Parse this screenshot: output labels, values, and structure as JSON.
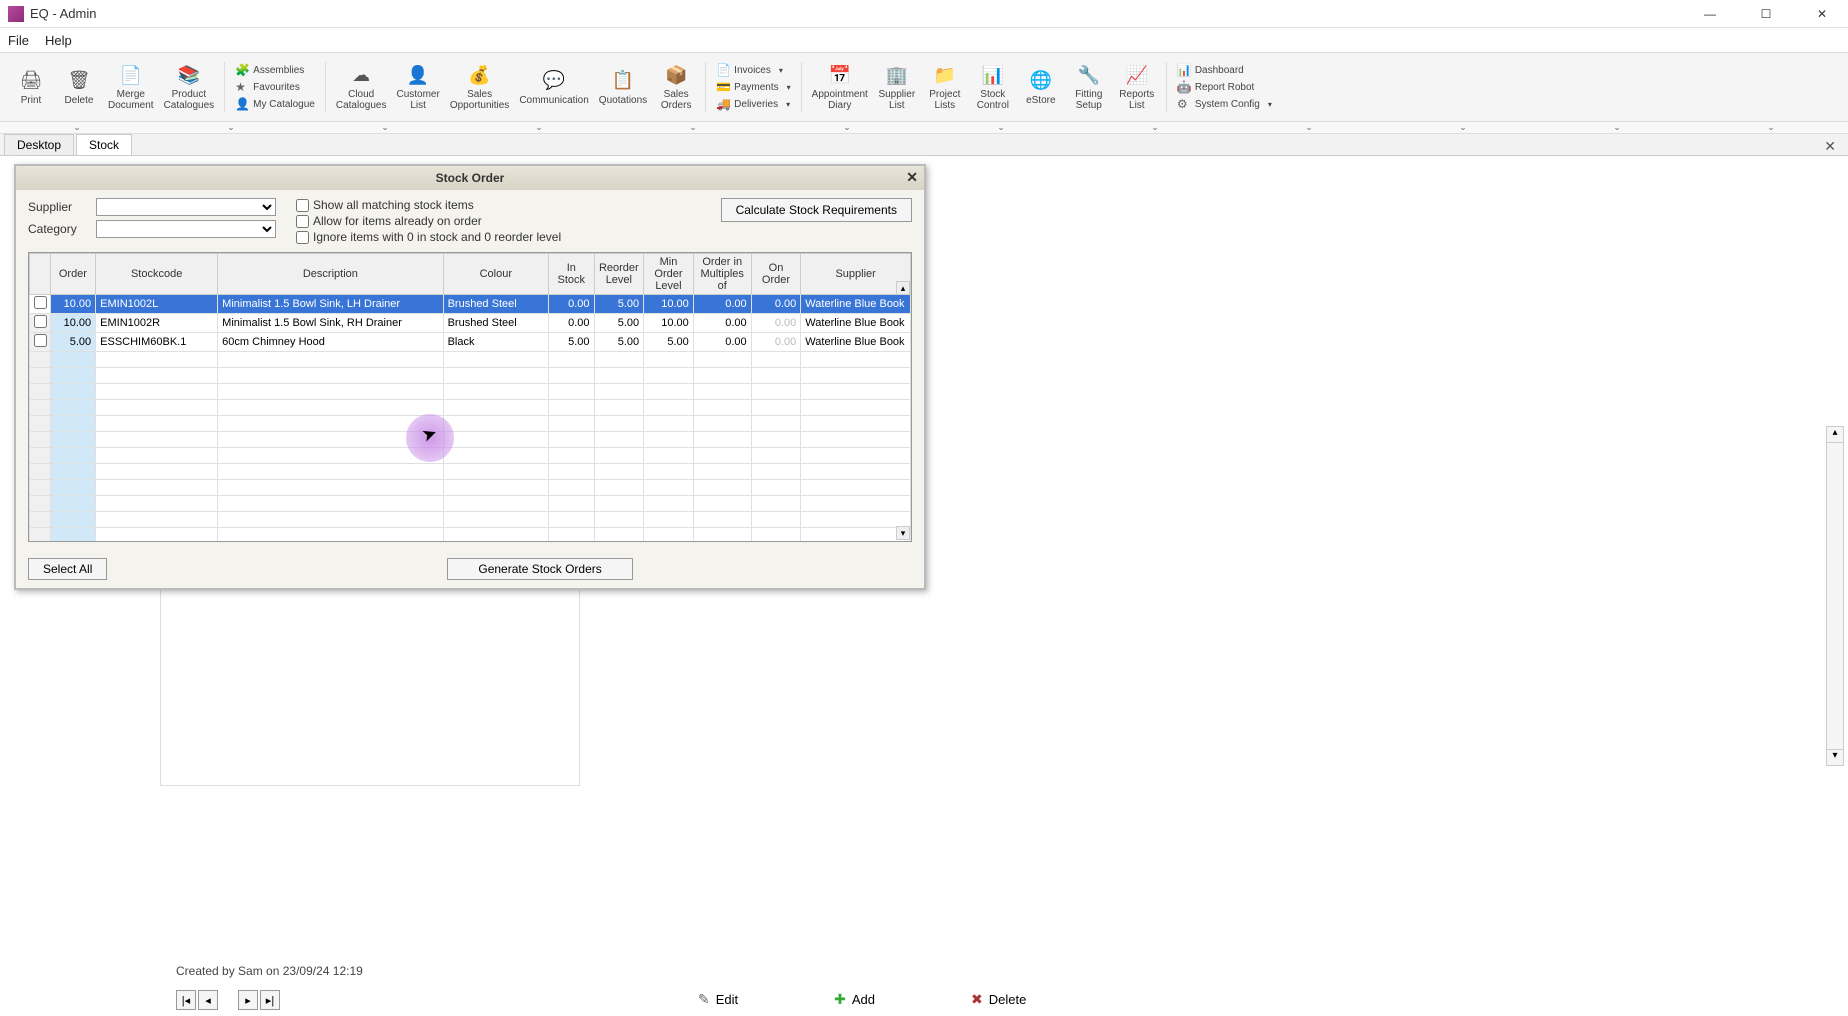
{
  "app": {
    "title": "EQ - Admin"
  },
  "menu": [
    "File",
    "Help"
  ],
  "ribbon": {
    "items": [
      {
        "label": "Print",
        "icon": "🖨"
      },
      {
        "label": "Delete",
        "icon": "🗑"
      },
      {
        "label": "Merge\nDocument",
        "icon": "📄"
      },
      {
        "label": "Product\nCatalogues",
        "icon": "📚"
      }
    ],
    "group1": [
      {
        "icon": "🧩",
        "label": "Assemblies"
      },
      {
        "icon": "★",
        "label": "Favourites"
      },
      {
        "icon": "👤",
        "label": "My Catalogue"
      }
    ],
    "items2": [
      {
        "label": "Cloud\nCatalogues",
        "icon": "☁"
      },
      {
        "label": "Customer\nList",
        "icon": "👤"
      },
      {
        "label": "Sales\nOpportunities",
        "icon": "💰"
      },
      {
        "label": "Communication",
        "icon": "💬"
      },
      {
        "label": "Quotations",
        "icon": "📋"
      },
      {
        "label": "Sales\nOrders",
        "icon": "📦"
      }
    ],
    "group2": [
      {
        "icon": "📄",
        "label": "Invoices"
      },
      {
        "icon": "💳",
        "label": "Payments"
      },
      {
        "icon": "🚚",
        "label": "Deliveries"
      }
    ],
    "items3": [
      {
        "label": "Appointment\nDiary",
        "icon": "📅"
      },
      {
        "label": "Supplier\nList",
        "icon": "🏢"
      },
      {
        "label": "Project\nLists",
        "icon": "📁"
      },
      {
        "label": "Stock\nControl",
        "icon": "📊"
      },
      {
        "label": "eStore",
        "icon": "🌐"
      },
      {
        "label": "Fitting\nSetup",
        "icon": "🔧"
      },
      {
        "label": "Reports\nList",
        "icon": "📈"
      }
    ],
    "group3": [
      {
        "icon": "📊",
        "label": "Dashboard"
      },
      {
        "icon": "🤖",
        "label": "Report Robot"
      },
      {
        "icon": "⚙",
        "label": "System Config"
      }
    ]
  },
  "tabs": [
    "Desktop",
    "Stock"
  ],
  "dialog": {
    "title": "Stock Order",
    "supplier_label": "Supplier",
    "category_label": "Category",
    "checks": [
      "Show all matching stock items",
      "Allow for items already on order",
      "Ignore items with 0 in stock and 0 reorder level"
    ],
    "calc_btn": "Calculate Stock Requirements",
    "columns": [
      "",
      "Order",
      "Stockcode",
      "Description",
      "Colour",
      "In Stock",
      "Reorder Level",
      "Min Order Level",
      "Order in Multiples of",
      "On Order",
      "Supplier"
    ],
    "rows": [
      {
        "selected": true,
        "order": "10.00",
        "stockcode": "EMIN1002L",
        "description": "Minimalist 1.5 Bowl Sink, LH Drainer",
        "colour": "Brushed Steel",
        "in_stock": "0.00",
        "reorder": "5.00",
        "min_order": "10.00",
        "multiples": "0.00",
        "on_order": "0.00",
        "supplier": "Waterline Blue Book"
      },
      {
        "selected": false,
        "order": "10.00",
        "stockcode": "EMIN1002R",
        "description": "Minimalist 1.5 Bowl Sink, RH Drainer",
        "colour": "Brushed Steel",
        "in_stock": "0.00",
        "reorder": "5.00",
        "min_order": "10.00",
        "multiples": "0.00",
        "on_order": "0.00",
        "supplier": "Waterline Blue Book"
      },
      {
        "selected": false,
        "order": "5.00",
        "stockcode": "ESSCHIM60BK.1",
        "description": "60cm Chimney Hood",
        "colour": "Black",
        "in_stock": "5.00",
        "reorder": "5.00",
        "min_order": "5.00",
        "multiples": "0.00",
        "on_order": "0.00",
        "supplier": "Waterline Blue Book"
      }
    ],
    "select_all": "Select All",
    "generate": "Generate Stock Orders"
  },
  "status": "Created by Sam on 23/09/24 12:19",
  "actions": {
    "edit": "Edit",
    "add": "Add",
    "delete": "Delete"
  }
}
